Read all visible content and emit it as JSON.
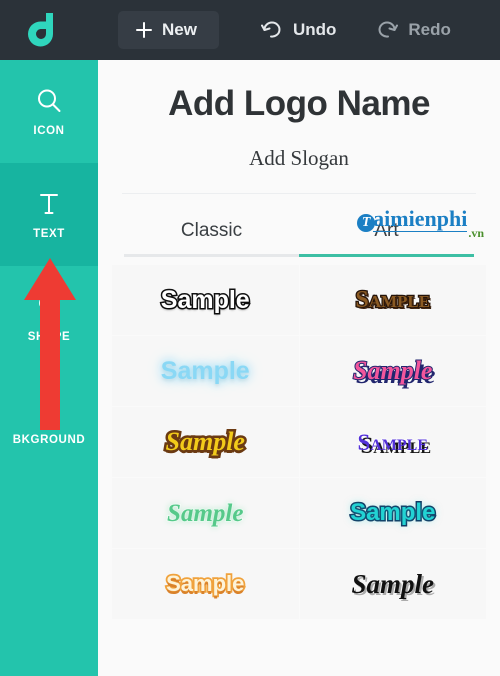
{
  "topbar": {
    "logo_icon": "app-logo-droplet-icon",
    "logo_color": "#2fd6bd",
    "background": "#2b3239",
    "new_label": "New",
    "new_icon": "plus-icon",
    "undo_label": "Undo",
    "undo_icon": "undo-arrow-icon",
    "redo_label": "Redo",
    "redo_icon": "redo-arrow-icon"
  },
  "sidebar": {
    "background": "#23c4ac",
    "active_background": "#17b4a0",
    "items": [
      {
        "label": "ICON",
        "icon": "magnifier-icon",
        "active": false
      },
      {
        "label": "TEXT",
        "icon": "text-t-icon",
        "active": true
      },
      {
        "label": "SHAPE",
        "icon": "shapes-icon",
        "active": false
      },
      {
        "label": "BKGROUND",
        "icon": "hatched-square-icon",
        "active": false
      }
    ]
  },
  "annotation": {
    "arrow_name": "red-arrow-pointing-to-text",
    "color": "#ee3b33",
    "points_to": "TEXT"
  },
  "canvas": {
    "logo_name": "Add Logo Name",
    "slogan": "Add Slogan"
  },
  "watermark": {
    "badge_letter": "T",
    "name": "aimienphi",
    "tld": ".vn",
    "brand_color": "#1b7fc4",
    "tld_color": "#4a8f2c"
  },
  "tabs": [
    {
      "label": "Classic",
      "active": false
    },
    {
      "label": "Art",
      "active": true
    }
  ],
  "styles": {
    "accent": "#3dbfa4",
    "samples": [
      {
        "text": "Sample",
        "style": "s1",
        "name": "white-black-outline"
      },
      {
        "text": "Sample",
        "style": "s2",
        "name": "brown-smallcaps-wood"
      },
      {
        "text": "Sample",
        "style": "s3",
        "name": "light-blue-glow"
      },
      {
        "text": "Sample",
        "style": "s4",
        "name": "pink-navy-shadow-script"
      },
      {
        "text": "Sample",
        "style": "s5",
        "name": "yellow-brown-outline-script"
      },
      {
        "text": "Sample",
        "style": "s6",
        "name": "purple-smallcaps-hardshadow"
      },
      {
        "text": "Sample",
        "style": "s7",
        "name": "green-glow-script"
      },
      {
        "text": "Sample",
        "style": "s8",
        "name": "cyan-navy-outline"
      },
      {
        "text": "Sample",
        "style": "s9",
        "name": "cream-orange-smallcaps"
      },
      {
        "text": "Sample",
        "style": "s10",
        "name": "black-brush-script"
      }
    ]
  }
}
